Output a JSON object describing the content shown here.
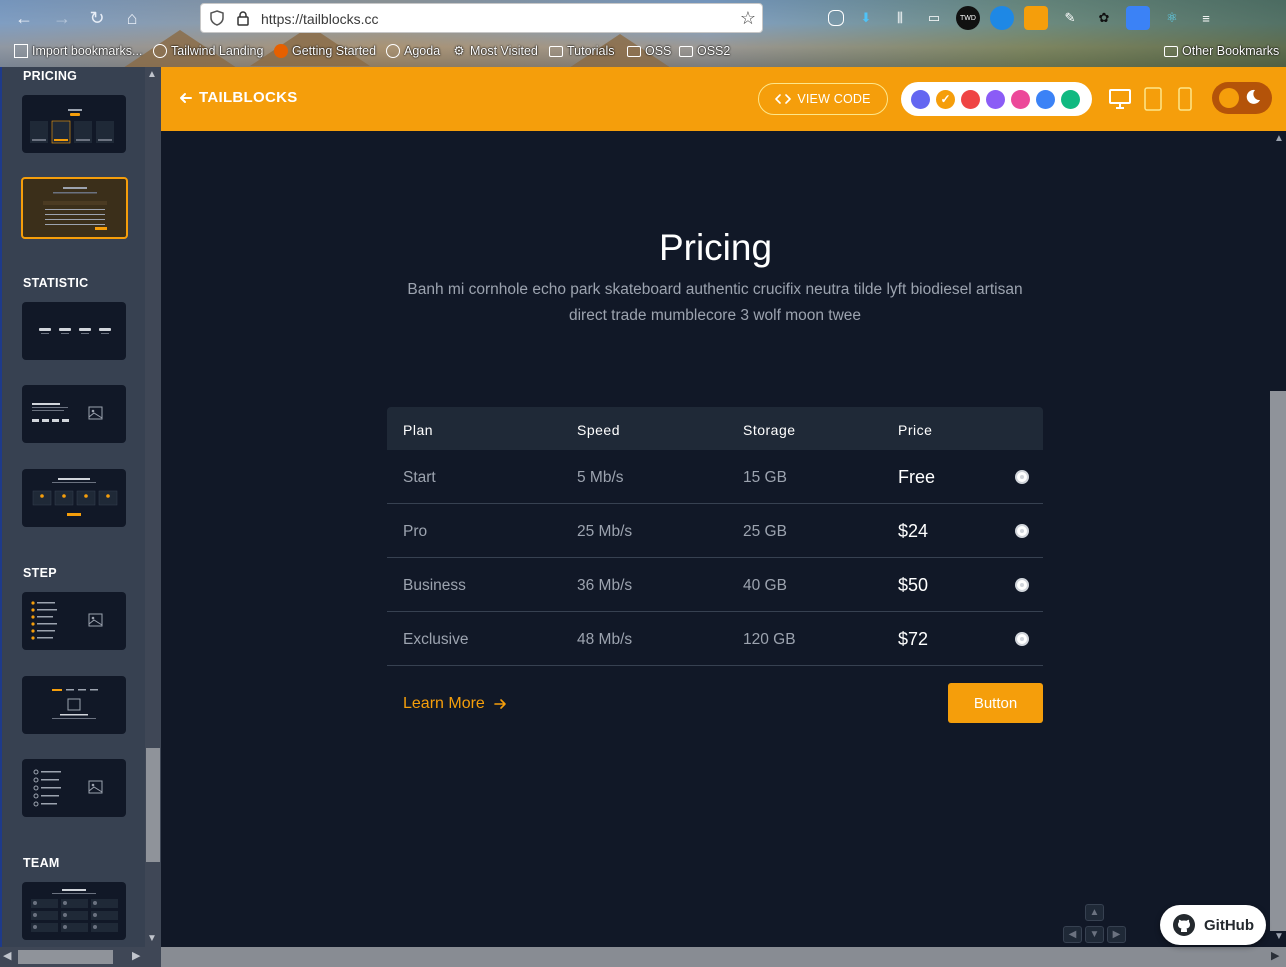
{
  "browser": {
    "url": "https://tailblocks.cc",
    "bookmarks": [
      "Import bookmarks...",
      "Tailwind Landing",
      "Getting Started",
      "Agoda",
      "Most Visited",
      "Tutorials",
      "OSS",
      "OSS2",
      "Other Bookmarks"
    ]
  },
  "sidebar": {
    "sections": [
      "PRICING",
      "STATISTIC",
      "STEP",
      "TEAM"
    ]
  },
  "header": {
    "back_label": "TAILBLOCKS",
    "view_code_label": "VIEW CODE",
    "colors": [
      "#6366f1",
      "#f59e0b",
      "#ef4444",
      "#8b5cf6",
      "#ec4899",
      "#3b82f6",
      "#10b981"
    ],
    "selected_color": "#f59e0b",
    "accent": "#f59e0b"
  },
  "content": {
    "title": "Pricing",
    "subtitle": "Banh mi cornhole echo park skateboard authentic crucifix neutra tilde lyft biodiesel artisan direct trade mumblecore 3 wolf moon twee",
    "columns": [
      "Plan",
      "Speed",
      "Storage",
      "Price"
    ],
    "rows": [
      {
        "plan": "Start",
        "speed": "5 Mb/s",
        "storage": "15 GB",
        "price": "Free"
      },
      {
        "plan": "Pro",
        "speed": "25 Mb/s",
        "storage": "25 GB",
        "price": "$24"
      },
      {
        "plan": "Business",
        "speed": "36 Mb/s",
        "storage": "40 GB",
        "price": "$50"
      },
      {
        "plan": "Exclusive",
        "speed": "48 Mb/s",
        "storage": "120 GB",
        "price": "$72"
      }
    ],
    "learn_more": "Learn More",
    "button_label": "Button"
  },
  "github_label": "GitHub"
}
